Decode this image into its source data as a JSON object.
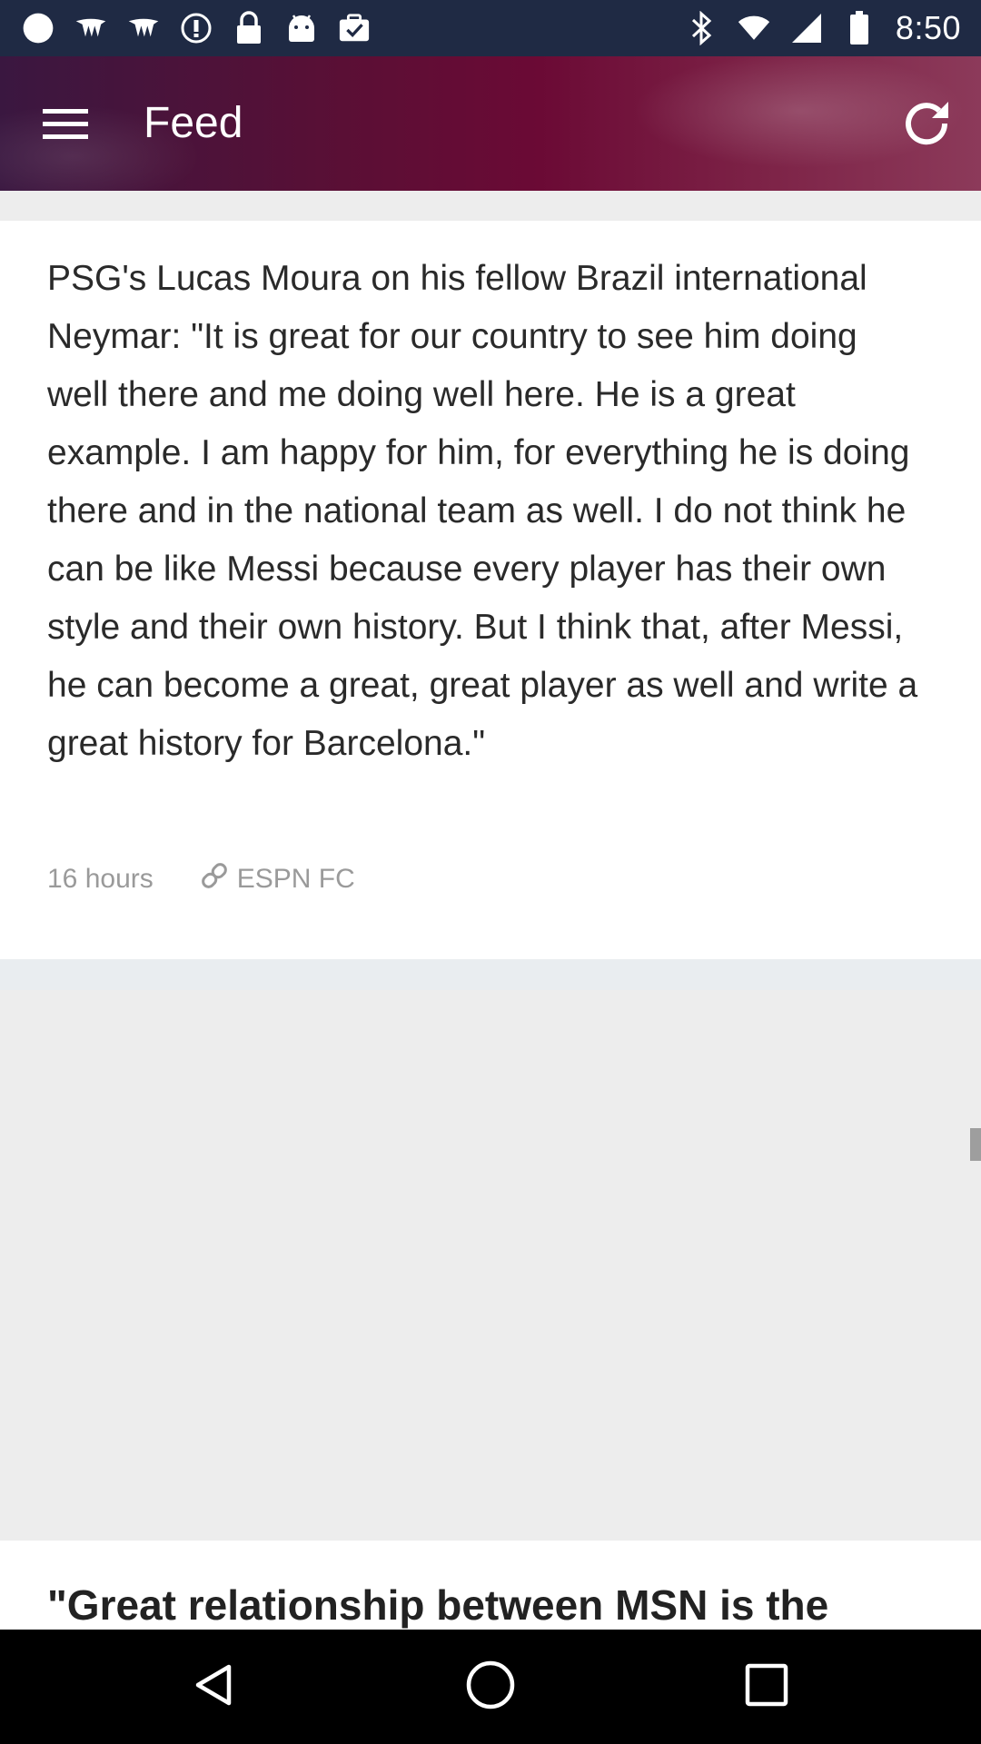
{
  "status_bar": {
    "time": "8:50",
    "left_icons": [
      "circle-notification-icon",
      "wing-app-icon",
      "wing-app-icon-2",
      "info-circle-icon",
      "lock-icon",
      "android-icon",
      "briefcase-check-icon"
    ],
    "right_icons": [
      "bluetooth-icon",
      "wifi-icon",
      "signal-icon",
      "battery-icon"
    ]
  },
  "app_bar": {
    "title": "Feed",
    "menu_icon": "hamburger-menu-icon",
    "refresh_icon": "refresh-icon"
  },
  "feed": {
    "items": [
      {
        "text": "PSG's Lucas Moura on his fellow Brazil international Neymar: \"It is great for our country to see him doing well there and me doing well here. He is a great example. I am happy for him, for everything he is doing there and in the national team as well. I do not think he can be like Messi because every player has their own style and their own history. But I think that, after Messi, he can become a great, great player as well and write a great history for Barcelona.\"",
        "time": "16 hours",
        "source": "ESPN FC"
      },
      {
        "title": "\"Great relationship between MSN is the"
      }
    ]
  },
  "nav_bar": {
    "back_icon": "back-triangle-icon",
    "home_icon": "home-circle-icon",
    "recents_icon": "recents-square-icon"
  },
  "colors": {
    "status_bar_bg": "#1f2a44",
    "app_bar_accent": "#6b0a35",
    "meta_text": "#9a9a9a",
    "background": "#ededed"
  }
}
